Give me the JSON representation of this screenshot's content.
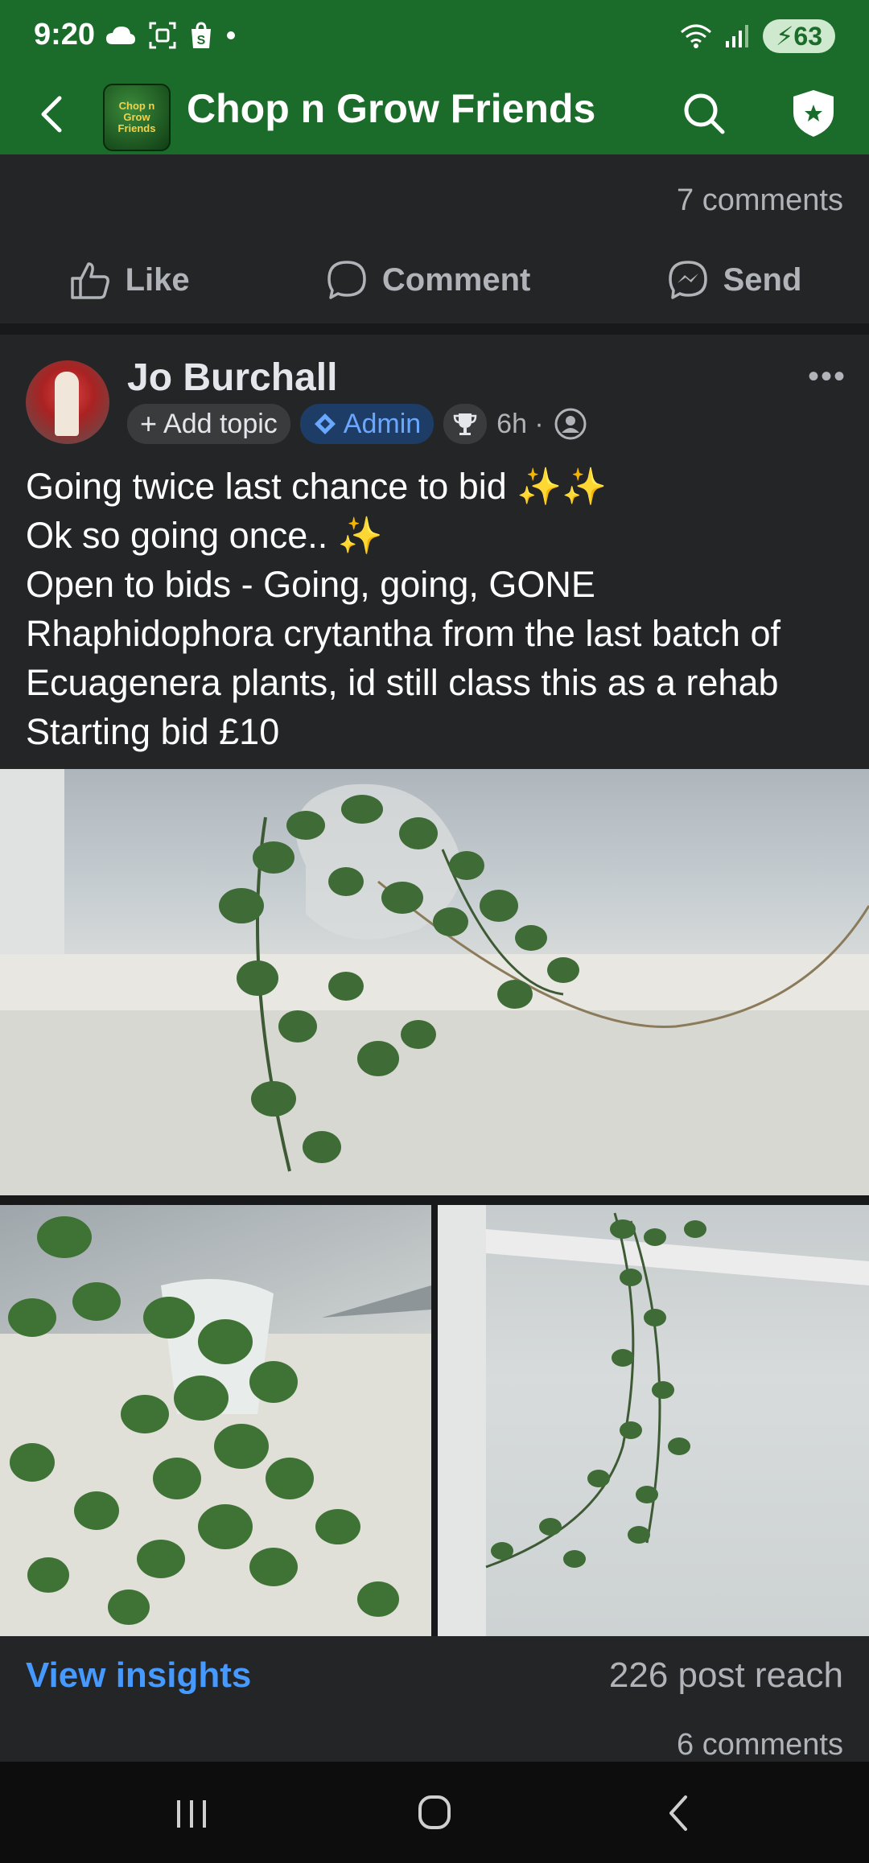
{
  "status": {
    "time": "9:20",
    "battery": "63",
    "icons": [
      "cloud-icon",
      "screenshot-icon",
      "shop-icon",
      "dot-icon"
    ],
    "right_icons": [
      "wifi-icon",
      "signal-icon"
    ]
  },
  "appbar": {
    "title": "Chop n Grow Friends",
    "logo_text": "Chop n Grow Friends"
  },
  "prev_post": {
    "comments": "7 comments",
    "actions": {
      "like": "Like",
      "comment": "Comment",
      "send": "Send"
    }
  },
  "post": {
    "author": "Jo Burchall",
    "add_topic": "Add topic",
    "admin": "Admin",
    "time": "6h ·",
    "lines": [
      "Going twice last chance to bid ✨✨",
      "Ok so going once..   ✨",
      "Open to bids - Going, going, GONE",
      "Rhaphidophora crytantha from the last batch of",
      "Ecuagenera plants, id still class this as a rehab",
      "Starting bid £10"
    ],
    "insights": "View insights",
    "reach": "226 post reach",
    "comments": "6 comments"
  },
  "colors": {
    "brand_green": "#1b6b2a",
    "link_blue": "#4599ff",
    "background": "#242526"
  }
}
